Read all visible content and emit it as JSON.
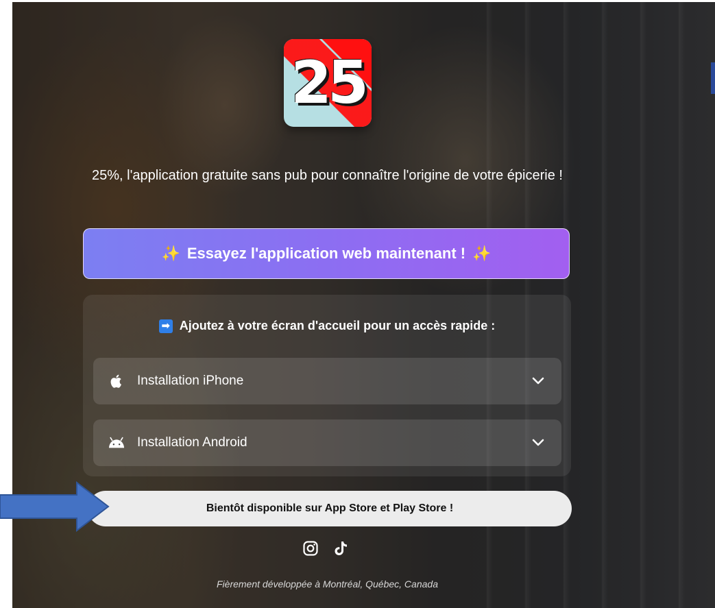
{
  "logo": {
    "text": "25"
  },
  "tagline": "25%, l'application gratuite sans pub pour connaître l'origine de votre épicerie !",
  "cta": {
    "label": "Essayez l'application web maintenant !"
  },
  "install": {
    "heading": "Ajoutez à votre écran d'accueil pour un accès rapide :",
    "items": [
      {
        "label": "Installation iPhone",
        "icon": "apple-icon"
      },
      {
        "label": "Installation Android",
        "icon": "android-icon"
      }
    ]
  },
  "store_notice": "Bientôt disponible sur App Store et Play Store !",
  "socials": [
    "instagram-icon",
    "tiktok-icon"
  ],
  "footer": "Fièrement développée à Montréal, Québec, Canada",
  "colors": {
    "cta_start": "#7c7ff2",
    "cta_end": "#a25ff0",
    "sparkle": "#ffd84a",
    "arrow_annotation": "#4472c4",
    "heading_arrow": "#2f7fe8"
  }
}
